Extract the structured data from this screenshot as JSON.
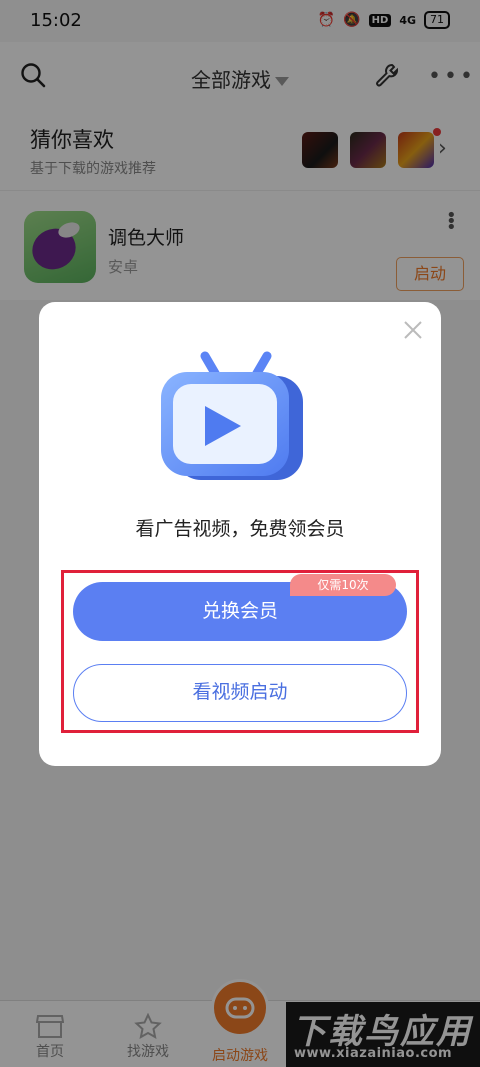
{
  "status_bar": {
    "time": "15:02",
    "hd": "HD",
    "signal": "4G",
    "battery": "71"
  },
  "header": {
    "title": "全部游戏"
  },
  "recommend": {
    "title": "猜你喜欢",
    "subtitle": "基于下载的游戏推荐"
  },
  "app": {
    "name": "调色大师",
    "platform": "安卓",
    "launch_label": "启动"
  },
  "dialog": {
    "message": "看广告视频，免费领会员",
    "exchange_label": "兑换会员",
    "badge": "仅需10次",
    "video_label": "看视频启动"
  },
  "bottom_nav": {
    "home": "首页",
    "find": "找游戏",
    "launch": "启动游戏"
  },
  "watermark": {
    "line1": "下载鸟应用",
    "line2": "www.xiazainiao.com"
  },
  "colors": {
    "accent": "#5b7ff2",
    "orange": "#f07a2a",
    "highlight": "#e0203a"
  }
}
